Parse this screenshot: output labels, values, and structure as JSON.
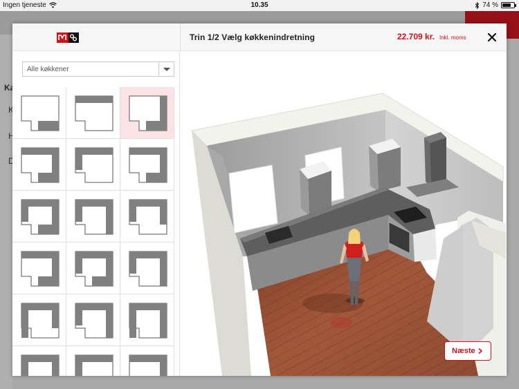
{
  "status_bar": {
    "carrier": "Ingen tjeneste",
    "time": "10.35",
    "battery_percent": "74 %",
    "battery_level": 0.74
  },
  "background_app": {
    "sidebar_letters": [
      "Ka",
      "K",
      "H",
      "D"
    ]
  },
  "modal": {
    "step_title": "Trin 1/2 Vælg køkkenindretning",
    "price": "22.709 kr.",
    "price_note": "Inkl. moms",
    "filter": {
      "selected": "Alle køkkener"
    },
    "layouts": [
      {
        "id": 1,
        "selected": false
      },
      {
        "id": 2,
        "selected": false
      },
      {
        "id": 3,
        "selected": true
      },
      {
        "id": 4,
        "selected": false
      },
      {
        "id": 5,
        "selected": false
      },
      {
        "id": 6,
        "selected": false
      },
      {
        "id": 7,
        "selected": false
      },
      {
        "id": 8,
        "selected": false
      },
      {
        "id": 9,
        "selected": false
      },
      {
        "id": 10,
        "selected": false
      },
      {
        "id": 11,
        "selected": false
      },
      {
        "id": 12,
        "selected": false
      },
      {
        "id": 13,
        "selected": false
      },
      {
        "id": 14,
        "selected": false
      },
      {
        "id": 15,
        "selected": false
      },
      {
        "id": 16,
        "selected": false
      },
      {
        "id": 17,
        "selected": false
      },
      {
        "id": 18,
        "selected": false
      }
    ],
    "next_label": "Næste"
  },
  "colors": {
    "accent": "#d0101a",
    "selected_cell": "#fbe3e5",
    "cabinet": "#808080"
  },
  "icons": {
    "close": "close-icon",
    "chevron": "chevron-right-icon",
    "dropdown": "chevron-down-icon",
    "wifi": "wifi-icon",
    "bluetooth": "bluetooth-icon"
  }
}
